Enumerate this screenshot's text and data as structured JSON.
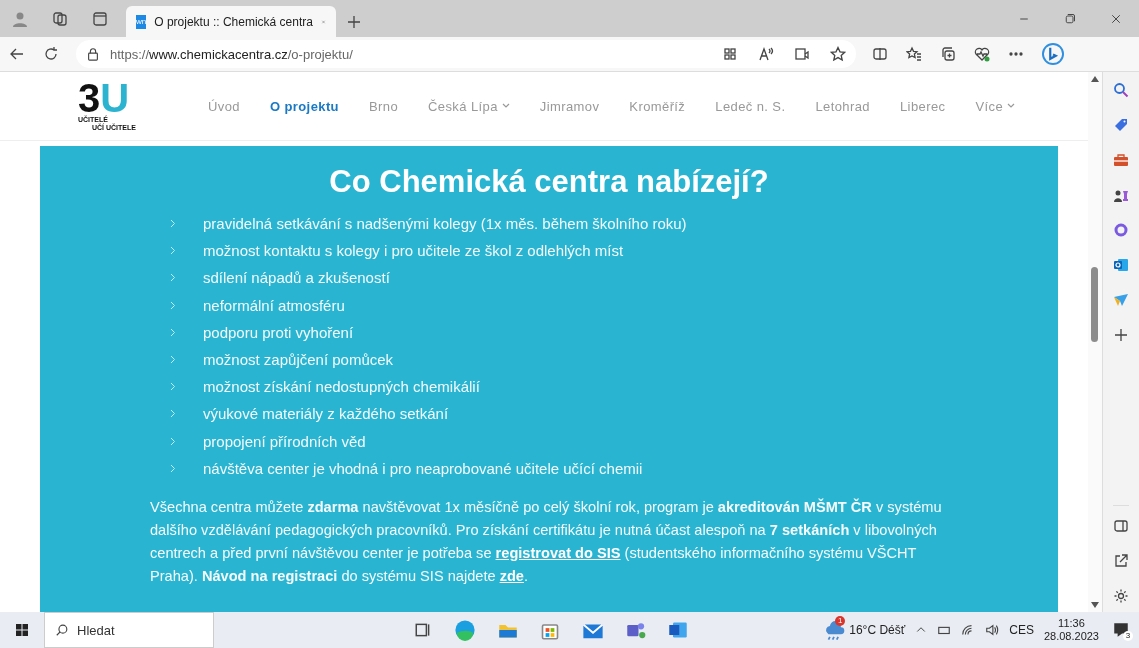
{
  "browser": {
    "tab": {
      "favicon": "wn",
      "title": "O projektu :: Chemická centra"
    },
    "url": {
      "scheme": "https://",
      "host": "www.chemickacentra.cz",
      "path": "/o-projektu/"
    }
  },
  "site": {
    "logo": {
      "mark_1": "3",
      "mark_2": "U",
      "line_1": "UČITELÉ",
      "line_2": "UČÍ UČITELE"
    },
    "nav": [
      {
        "label": "Úvod",
        "selected": false,
        "dropdown": false
      },
      {
        "label": "O projektu",
        "selected": true,
        "dropdown": false
      },
      {
        "label": "Brno",
        "selected": false,
        "dropdown": false
      },
      {
        "label": "Česká Lípa",
        "selected": false,
        "dropdown": true
      },
      {
        "label": "Jimramov",
        "selected": false,
        "dropdown": false
      },
      {
        "label": "Kroměříž",
        "selected": false,
        "dropdown": false
      },
      {
        "label": "Ledeč n. S.",
        "selected": false,
        "dropdown": false
      },
      {
        "label": "Letohrad",
        "selected": false,
        "dropdown": false
      },
      {
        "label": "Liberec",
        "selected": false,
        "dropdown": false
      },
      {
        "label": "Více",
        "selected": false,
        "dropdown": true
      }
    ]
  },
  "section": {
    "title": "Co Chemická centra nabízejí?",
    "bullets": [
      "pravidelná setkávání s nadšenými kolegy (1x měs. během školního roku)",
      "možnost kontaktu s kolegy i pro učitele ze škol z odlehlých míst",
      "sdílení nápadů a zkušeností",
      "neformální atmosféru",
      "podporu proti vyhoření",
      "možnost zapůjčení pomůcek",
      "možnost získání nedostupných chemikálií",
      "výukové materiály z každého setkání",
      "propojení přírodních věd",
      "návštěva center je vhodná i pro neaprobované učitele učící chemii"
    ],
    "paragraph": [
      {
        "kind": "text",
        "text": "Všechna centra můžete **zdarma** navštěvovat 1x měsíčně po celý školní rok, program je **akreditován MŠMT ČR** v systému dalšího vzdělávání pedagogických pracovníků. Pro získání certifikátu je nutná účast alespoň na **7 setkáních** v libovolných centrech a před první návštěvou center je potřeba se "
      },
      {
        "kind": "link",
        "text": "registrovat do SIS"
      },
      {
        "kind": "text",
        "text": " (studentského informačního systému VŠCHT Praha). **Návod na registraci** do systému SIS najdete "
      },
      {
        "kind": "link",
        "text": "zde"
      },
      {
        "kind": "text",
        "text": "."
      }
    ]
  },
  "taskbar": {
    "search_placeholder": "Hledat",
    "weather": "16°C  Déšť",
    "weather_badge": "1",
    "language": "CES",
    "time": "11:36",
    "date": "28.08.2023",
    "notification_count": "3"
  }
}
